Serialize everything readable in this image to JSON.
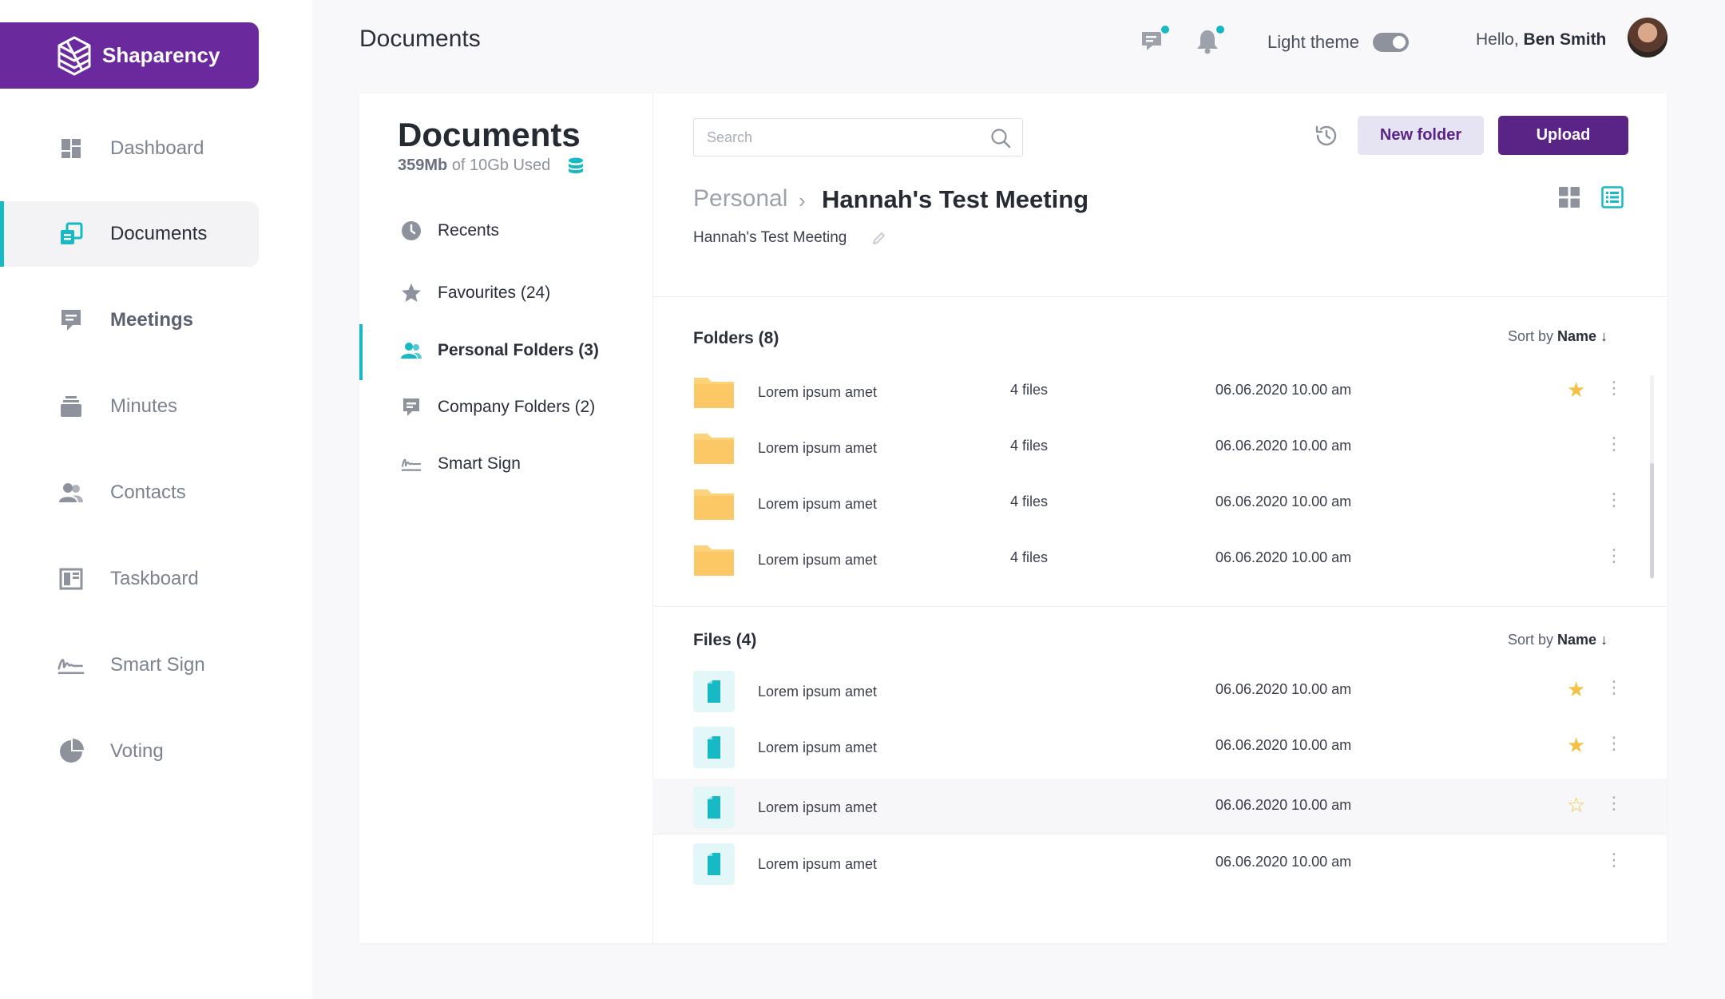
{
  "app": {
    "brand": "Shaparency"
  },
  "sidebar": {
    "items": [
      {
        "label": "Dashboard",
        "icon": "dashboard-icon"
      },
      {
        "label": "Documents",
        "icon": "documents-icon"
      },
      {
        "label": "Meetings",
        "icon": "meetings-icon"
      },
      {
        "label": "Minutes",
        "icon": "minutes-icon"
      },
      {
        "label": "Contacts",
        "icon": "contacts-icon"
      },
      {
        "label": "Taskboard",
        "icon": "taskboard-icon"
      },
      {
        "label": "Smart Sign",
        "icon": "smart-sign-icon"
      },
      {
        "label": "Voting",
        "icon": "voting-icon"
      }
    ]
  },
  "header": {
    "title": "Documents",
    "theme_label": "Light theme",
    "greeting_prefix": "Hello,",
    "user_name": "Ben Smith"
  },
  "documents": {
    "title": "Documents",
    "storage_used": "359Mb",
    "storage_total": "of 10Gb Used",
    "menu": [
      {
        "label": "Recents",
        "icon": "clock-icon"
      },
      {
        "label": "Favourites (24)",
        "icon": "star-icon"
      },
      {
        "label": "Personal Folders (3)",
        "icon": "person-icon"
      },
      {
        "label": "Company Folders (2)",
        "icon": "chat-icon"
      },
      {
        "label": "Smart Sign",
        "icon": "signature-icon"
      }
    ]
  },
  "toolbar": {
    "search_placeholder": "Search",
    "new_folder_label": "New folder",
    "upload_label": "Upload"
  },
  "breadcrumb": {
    "parent": "Personal",
    "separator": "›",
    "current": "Hannah's Test Meeting",
    "caption": "Hannah's Test Meeting"
  },
  "folders": {
    "title": "Folders (8)",
    "sort_prefix": "Sort by",
    "sort_field": "Name ↓",
    "rows": [
      {
        "name": "Lorem ipsum amet",
        "count": "4 files",
        "date": "06.06.2020  10.00 am",
        "starred": true
      },
      {
        "name": "Lorem ipsum amet",
        "count": "4 files",
        "date": "06.06.2020  10.00 am",
        "starred": false
      },
      {
        "name": "Lorem ipsum amet",
        "count": "4 files",
        "date": "06.06.2020  10.00 am",
        "starred": false
      },
      {
        "name": "Lorem ipsum amet",
        "count": "4 files",
        "date": "06.06.2020  10.00 am",
        "starred": false
      }
    ]
  },
  "files": {
    "title": "Files (4)",
    "sort_prefix": "Sort by",
    "sort_field": "Name ↓",
    "rows": [
      {
        "name": "Lorem ipsum amet",
        "date": "06.06.2020  10.00 am",
        "star": "filled"
      },
      {
        "name": "Lorem ipsum amet",
        "date": "06.06.2020  10.00 am",
        "star": "filled"
      },
      {
        "name": "Lorem ipsum amet",
        "date": "06.06.2020  10.00 am",
        "star": "outline"
      },
      {
        "name": "Lorem ipsum amet",
        "date": "06.06.2020  10.00 am",
        "star": "none"
      }
    ]
  },
  "colors": {
    "brand": "#6a2a9e",
    "accent": "#17b9c4",
    "star": "#f5c144",
    "folder": "#fcd27a"
  }
}
